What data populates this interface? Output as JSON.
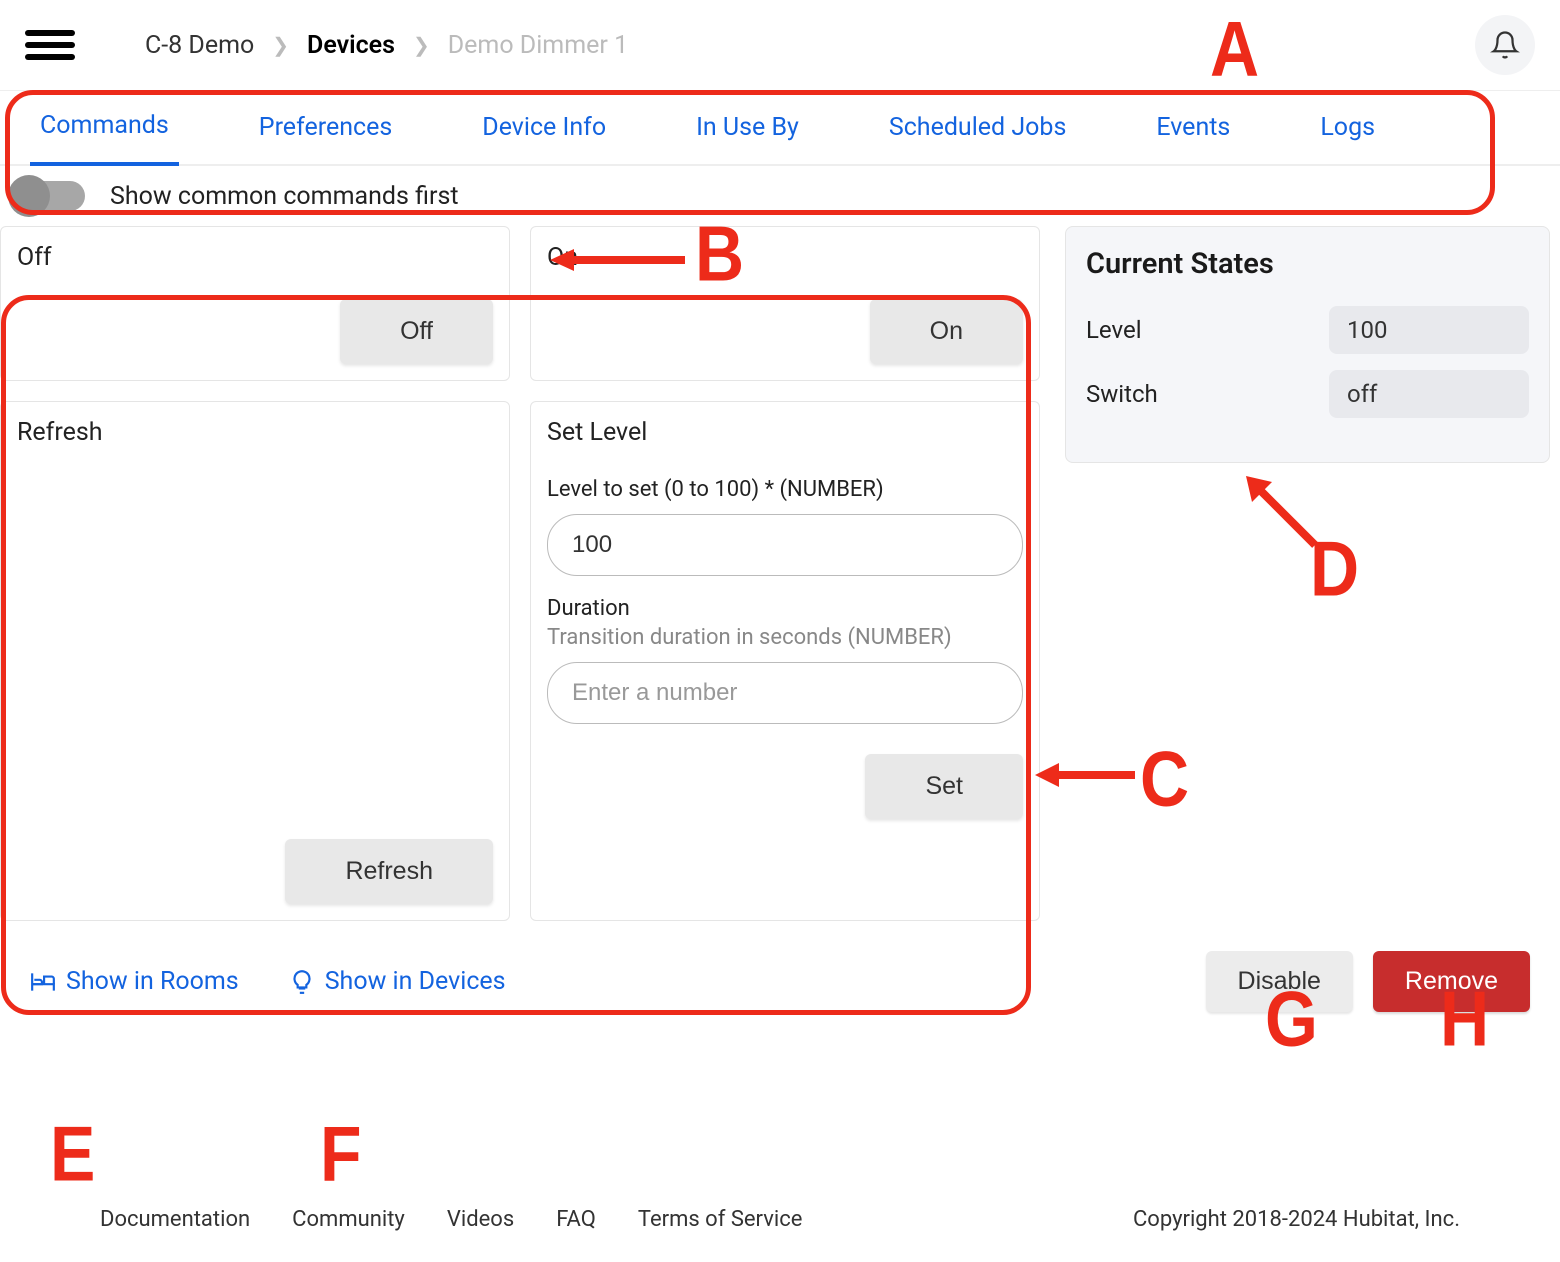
{
  "breadcrumb": {
    "hub": "C-8 Demo",
    "devices": "Devices",
    "device": "Demo Dimmer 1"
  },
  "tabs": {
    "commands": "Commands",
    "preferences": "Preferences",
    "device_info": "Device Info",
    "in_use_by": "In Use By",
    "scheduled_jobs": "Scheduled Jobs",
    "events": "Events",
    "logs": "Logs"
  },
  "toggle": {
    "label": "Show common commands first"
  },
  "commands": {
    "off": {
      "title": "Off",
      "button": "Off"
    },
    "on": {
      "title": "On",
      "button": "On"
    },
    "refresh": {
      "title": "Refresh",
      "button": "Refresh"
    },
    "set_level": {
      "title": "Set Level",
      "level_label": "Level to set (0 to 100) * (NUMBER)",
      "level_value": "100",
      "duration_label": "Duration",
      "duration_sub": "Transition duration in seconds (NUMBER)",
      "duration_placeholder": "Enter a number",
      "button": "Set"
    }
  },
  "states": {
    "heading": "Current States",
    "rows": [
      {
        "key": "Level",
        "value": "100"
      },
      {
        "key": "Switch",
        "value": "off"
      }
    ]
  },
  "bottom": {
    "show_rooms": "Show in Rooms",
    "show_devices": "Show in Devices",
    "disable": "Disable",
    "remove": "Remove"
  },
  "footer": {
    "documentation": "Documentation",
    "community": "Community",
    "videos": "Videos",
    "faq": "FAQ",
    "terms": "Terms of Service",
    "copyright": "Copyright 2018-2024 Hubitat, Inc."
  },
  "annotations": {
    "a": "A",
    "b": "B",
    "c": "C",
    "d": "D",
    "e": "E",
    "f": "F",
    "g": "G",
    "h": "H"
  }
}
